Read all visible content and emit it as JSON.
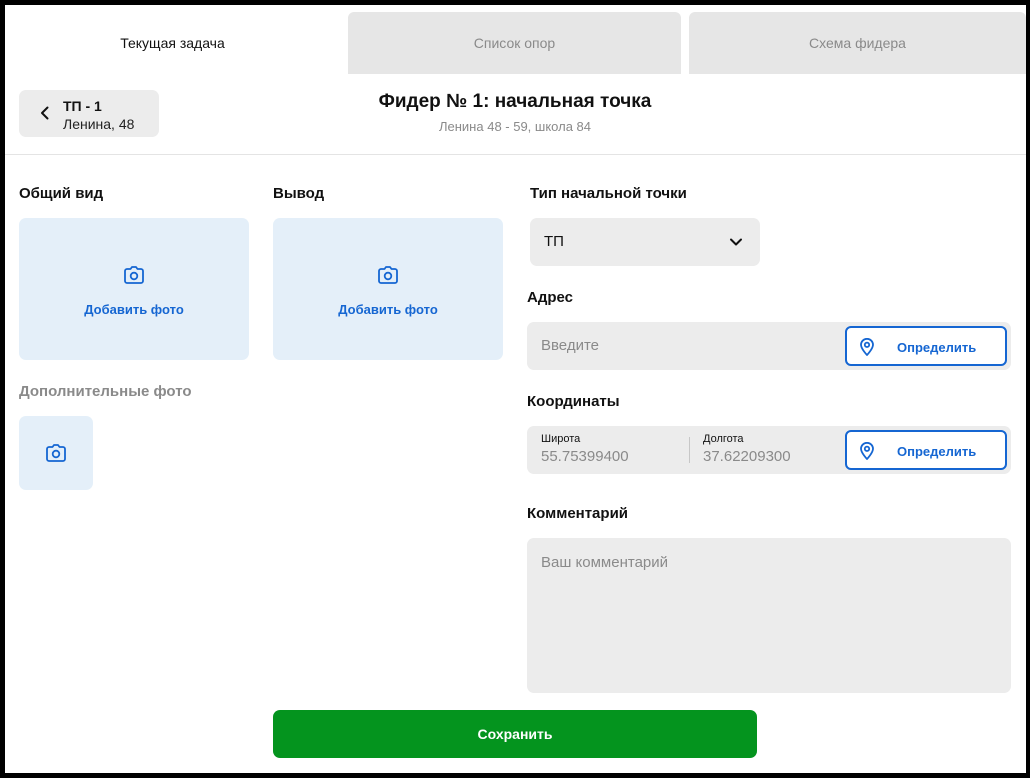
{
  "tabs": [
    {
      "label": "Текущая задача",
      "active": true
    },
    {
      "label": "Список опор",
      "active": false
    },
    {
      "label": "Схема фидера",
      "active": false
    }
  ],
  "back": {
    "title": "ТП - 1",
    "subtitle": "Ленина, 48",
    "icon": "chevron-left-icon"
  },
  "header": {
    "title": "Фидер № 1: начальная точка",
    "subtitle": "Ленина 48 - 59, школа 84"
  },
  "photos": {
    "general_label": "Общий вид",
    "output_label": "Вывод",
    "add_label": "Добавить фото",
    "extra_label": "Дополнительные фото",
    "icon": "camera-icon"
  },
  "point_type": {
    "label": "Тип начальной точки",
    "value": "ТП",
    "icon": "chevron-down-icon"
  },
  "address": {
    "label": "Адрес",
    "placeholder": "Введите",
    "detect_label": "Определить",
    "icon": "map-pin-icon"
  },
  "coordinates": {
    "label": "Координаты",
    "lat_label": "Широта",
    "lat_value": "55.75399400",
    "lon_label": "Долгота",
    "lon_value": "37.62209300",
    "detect_label": "Определить"
  },
  "comment": {
    "label": "Комментарий",
    "placeholder": "Ваш комментарий"
  },
  "save_label": "Сохранить",
  "colors": {
    "accent": "#1566d2",
    "save": "#04941e",
    "photo_bg": "#e4eff9",
    "field_bg": "#ececec"
  }
}
